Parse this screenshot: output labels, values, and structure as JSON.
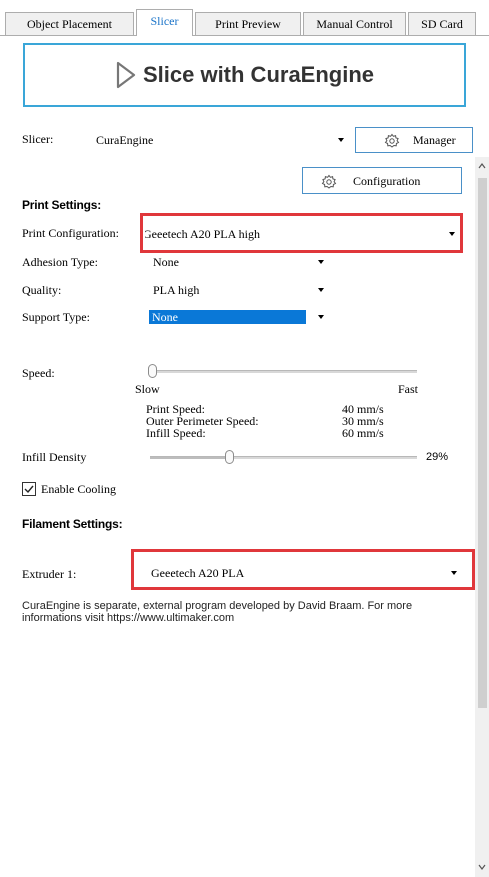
{
  "tabs": [
    {
      "label": "Object Placement",
      "active": false
    },
    {
      "label": "Slicer",
      "active": true
    },
    {
      "label": "Print Preview",
      "active": false
    },
    {
      "label": "Manual Control",
      "active": false
    },
    {
      "label": "SD Card",
      "active": false
    }
  ],
  "slice_button": {
    "label": "Slice with CuraEngine",
    "icon": "play-outline-icon"
  },
  "slicer": {
    "label": "Slicer:",
    "value": "CuraEngine",
    "manager_label": "Manager",
    "manager_icon": "gear-icon"
  },
  "configuration_button": {
    "label": "Configuration",
    "icon": "gear-icon"
  },
  "print_settings": {
    "heading": "Print Settings:",
    "print_configuration": {
      "label": "Print Configuration:",
      "value": "Geeetech A20 PLA high"
    },
    "adhesion_type": {
      "label": "Adhesion Type:",
      "value": "None"
    },
    "quality": {
      "label": "Quality:",
      "value": "PLA high"
    },
    "support_type": {
      "label": "Support Type:",
      "value": "None"
    }
  },
  "speed": {
    "label": "Speed:",
    "slow_label": "Slow",
    "fast_label": "Fast",
    "level": 0,
    "rows": [
      {
        "name": "Print Speed:",
        "value": "40 mm/s"
      },
      {
        "name": "Outer Perimeter Speed:",
        "value": "30 mm/s"
      },
      {
        "name": "Infill Speed:",
        "value": "60 mm/s"
      }
    ]
  },
  "infill": {
    "label": "Infill Density",
    "value": "29%",
    "level": 0.29
  },
  "enable_cooling": {
    "label": "Enable Cooling",
    "checked": true
  },
  "filament_settings": {
    "heading": "Filament Settings:",
    "extruder": {
      "label": "Extruder 1:",
      "value": "Geeetech A20 PLA"
    }
  },
  "note": "CuraEngine is separate, external program developed by David Braam. For more informations visit https://www.ultimaker.com",
  "colors": {
    "accent": "#3aa6d8",
    "highlight": "#0a78d7",
    "annotation": "#e0373b"
  }
}
